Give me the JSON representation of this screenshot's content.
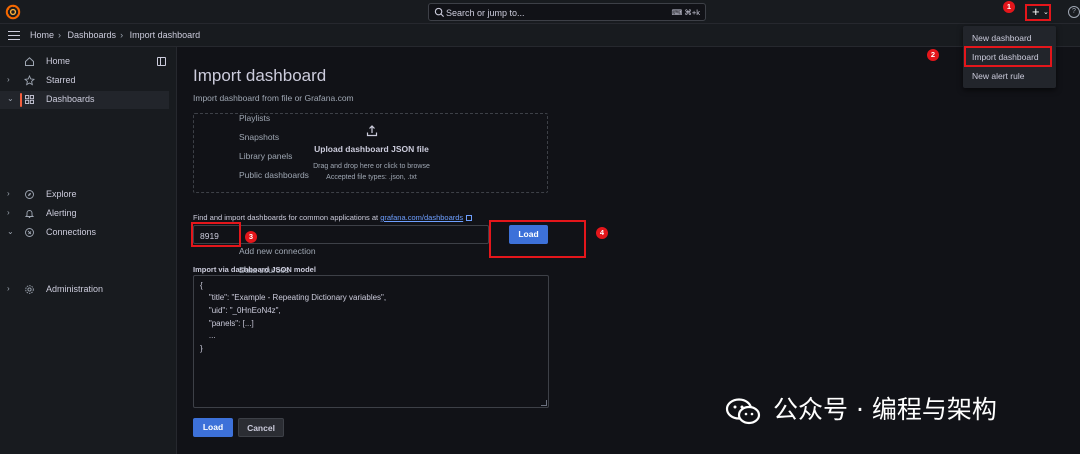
{
  "topbar": {
    "search_placeholder": "Search or jump to...",
    "search_shortcut": "⌘+k",
    "plus_label": "+",
    "chevron": "⌄",
    "help": "?"
  },
  "breadcrumb": {
    "items": [
      "Home",
      "Dashboards",
      "Import dashboard"
    ],
    "separator": "›"
  },
  "sidebar": {
    "items": [
      {
        "label": "Home",
        "icon": "home-icon",
        "caret": ""
      },
      {
        "label": "Starred",
        "icon": "star-icon",
        "caret": "›"
      },
      {
        "label": "Dashboards",
        "icon": "apps-icon",
        "caret": "⌄"
      },
      {
        "label": "Playlists"
      },
      {
        "label": "Snapshots"
      },
      {
        "label": "Library panels"
      },
      {
        "label": "Public dashboards"
      },
      {
        "label": "Explore",
        "icon": "compass-icon",
        "caret": "›"
      },
      {
        "label": "Alerting",
        "icon": "bell-icon",
        "caret": "›"
      },
      {
        "label": "Connections",
        "icon": "connections-icon",
        "caret": "⌄"
      },
      {
        "label": "Add new connection"
      },
      {
        "label": "Data sources"
      },
      {
        "label": "Administration",
        "icon": "gear-icon",
        "caret": "›"
      }
    ]
  },
  "page": {
    "title": "Import dashboard",
    "subtitle": "Import dashboard from file or Grafana.com"
  },
  "upload": {
    "title": "Upload dashboard JSON file",
    "line1": "Drag and drop here or click to browse",
    "line2": "Accepted file types: .json, .txt"
  },
  "find": {
    "label": "Find and import dashboards for common applications at",
    "link": "grafana.com/dashboards",
    "input_value": "8919",
    "load_label": "Load"
  },
  "json_model": {
    "label": "Import via dashboard JSON model",
    "lines": [
      "{",
      "    \"title\": \"Example - Repeating Dictionary variables\",",
      "    \"uid\": \"_0HnEoN4z\",",
      "    \"panels\": [...]",
      "    ...",
      "}"
    ]
  },
  "actions": {
    "load": "Load",
    "cancel": "Cancel"
  },
  "new_menu": {
    "items": [
      "New dashboard",
      "Import dashboard",
      "New alert rule"
    ]
  },
  "annotations": {
    "badges": [
      "1",
      "2",
      "3",
      "4"
    ],
    "color": "#e4161b"
  },
  "watermark": {
    "text": "公众号 · 编程与架构"
  },
  "colors": {
    "accent": "#3d71d9",
    "active_bar": "#f55f3e",
    "link": "#6e9fff"
  }
}
